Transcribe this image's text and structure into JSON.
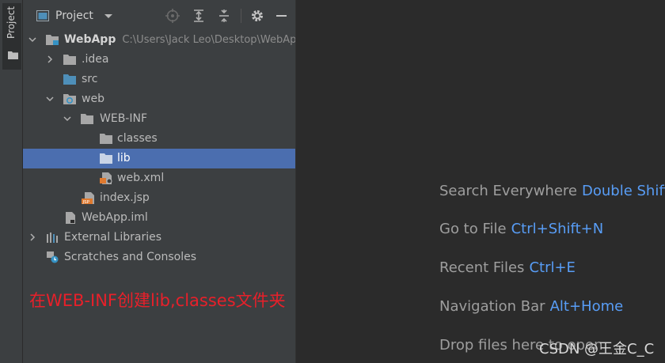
{
  "sidebar_stripe": {
    "tab_label": "Project"
  },
  "panel": {
    "title": "Project",
    "tree": [
      {
        "label": "WebApp",
        "path": "C:\\Users\\Jack Leo\\Desktop\\WebAp",
        "icon": "module-folder-icon",
        "expanded": true
      },
      {
        "label": ".idea",
        "icon": "folder-icon",
        "expanded": false
      },
      {
        "label": "src",
        "icon": "source-folder-icon"
      },
      {
        "label": "web",
        "icon": "web-folder-icon",
        "expanded": true
      },
      {
        "label": "WEB-INF",
        "icon": "folder-icon",
        "expanded": true
      },
      {
        "label": "classes",
        "icon": "folder-icon"
      },
      {
        "label": "lib",
        "icon": "folder-icon",
        "selected": true
      },
      {
        "label": "web.xml",
        "icon": "xml-file-icon"
      },
      {
        "label": "index.jsp",
        "icon": "jsp-file-icon"
      },
      {
        "label": "WebApp.iml",
        "icon": "iml-file-icon"
      },
      {
        "label": "External Libraries",
        "icon": "libraries-icon",
        "expanded": false
      },
      {
        "label": "Scratches and Consoles",
        "icon": "scratches-icon"
      }
    ]
  },
  "annotation": "在WEB-INF创建lib,classes文件夹",
  "editor_hints": [
    {
      "label": "Search Everywhere",
      "shortcut": "Double Shift"
    },
    {
      "label": "Go to File",
      "shortcut": "Ctrl+Shift+N"
    },
    {
      "label": "Recent Files",
      "shortcut": "Ctrl+E"
    },
    {
      "label": "Navigation Bar",
      "shortcut": "Alt+Home"
    },
    {
      "label": "Drop files here to open"
    }
  ],
  "watermark": "CSDN @王金C_C",
  "colors": {
    "selection": "#4b6eaf",
    "shortcut": "#589df6",
    "annotation": "#e8202a",
    "folder": "#a7a7a7",
    "source_folder": "#4e8fb9"
  }
}
